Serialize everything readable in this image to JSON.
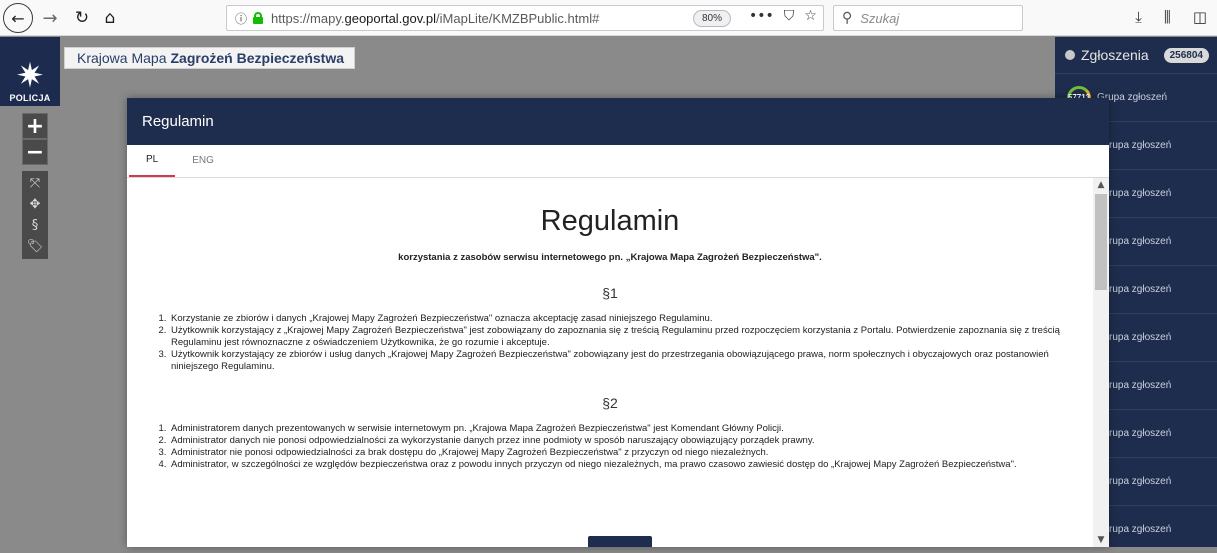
{
  "browser": {
    "url_prefix": "https://mapy.",
    "url_domain": "geoportal.gov.pl",
    "url_suffix": "/iMapLite/KMZBPublic.html#",
    "zoom": "80%",
    "search_placeholder": "Szukaj",
    "icons": [
      "back-icon",
      "forward-icon",
      "reload-icon",
      "home-icon",
      "info-icon",
      "lock-icon",
      "more-icon",
      "pocket-icon",
      "bookmark-star-icon",
      "search-icon",
      "download-icon",
      "library-icon",
      "sidebar-icon"
    ]
  },
  "app": {
    "logo_label": "POLICJA",
    "title_prefix": "Krajowa Mapa",
    "title_bold": "Zagrożeń Bezpieczeństwa"
  },
  "map_tools": {
    "zoom_in": "+",
    "zoom_out": "−",
    "extent": "⤧",
    "pan": "✥",
    "paragraph": "§",
    "tags": "🏷"
  },
  "reports": {
    "header": "Zgłoszenia",
    "count": "256804",
    "first_badge": "57713",
    "group_label": "Grupa zgłoszeń",
    "group_label_clipped": "rupa zgłoszeń"
  },
  "modal": {
    "title": "Regulamin",
    "tabs": [
      "PL",
      "ENG"
    ],
    "doc_title": "Regulamin",
    "doc_subtitle": "korzystania z zasobów serwisu internetowego pn. „Krajowa Mapa Zagrożeń Bezpieczeństwa\".",
    "sections": [
      {
        "mark": "§1",
        "items": [
          "Korzystanie ze zbiorów i danych „Krajowej Mapy Zagrożeń Bezpieczeństwa\" oznacza akceptację zasad niniejszego Regulaminu.",
          "Użytkownik korzystający z „Krajowej Mapy Zagrożeń Bezpieczeństwa\" jest zobowiązany do zapoznania się z treścią Regulaminu przed rozpoczęciem korzystania z Portalu. Potwierdzenie zapoznania się z treścią Regulaminu jest równoznaczne z oświadczeniem Użytkownika, że go rozumie i akceptuje.",
          "Użytkownik korzystający ze zbiorów i usług danych „Krajowej Mapy Zagrożeń Bezpieczeństwa\" zobowiązany jest do przestrzegania obowiązującego prawa, norm społecznych i obyczajowych oraz postanowień niniejszego Regulaminu."
        ]
      },
      {
        "mark": "§2",
        "items": [
          "Administratorem danych prezentowanych w serwisie internetowym pn. „Krajowa Mapa Zagrożeń Bezpieczeństwa\" jest Komendant Główny Policji.",
          "Administrator danych nie ponosi odpowiedzialności za wykorzystanie danych przez inne podmioty w sposób naruszający obowiązujący porządek prawny.",
          "Administrator nie ponosi odpowiedzialności za brak dostępu do „Krajowej Mapy Zagrożeń Bezpieczeństwa\" z przyczyn od niego niezależnych.",
          "Administrator, w szczególności ze względów bezpieczeństwa oraz z powodu innych przyczyn od niego niezależnych, ma prawo czasowo zawiesić dostęp do „Krajowej Mapy Zagrożeń Bezpieczeństwa\"."
        ]
      }
    ]
  },
  "colors": {
    "navy": "#1e2d4d",
    "tab_accent": "#d03a4a",
    "lock_green": "#12bc00"
  }
}
